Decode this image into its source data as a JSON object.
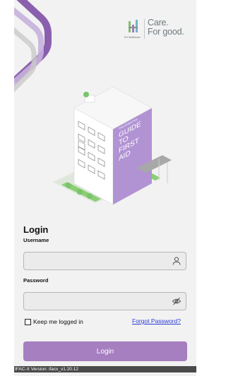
{
  "brand": {
    "small_text": "KH Healthcare",
    "tagline": "Care.\nFor good."
  },
  "illustration": {
    "banner_small": "THE ESSENTIAL",
    "banner_title_lines": [
      "GUIDE",
      "TO",
      "FIRST",
      "AID"
    ]
  },
  "login": {
    "title": "Login",
    "username_label": "Username",
    "username_value": "",
    "username_icon": "user-icon",
    "password_label": "Password",
    "password_value": "",
    "password_icon": "eye-off-icon",
    "remember_label": "Keep me logged in",
    "remember_checked": false,
    "forgot_label": "Forgot Password?",
    "button_label": "Login"
  },
  "footer": {
    "version": "IFAC-X Version: ifacx_v1.20.12"
  },
  "colors": {
    "accent": "#a57fbf",
    "building_purple": "#b193d4",
    "stripe_purple": "#8b5fb0",
    "link": "#2a3bd6",
    "green": "#7ac46c"
  }
}
